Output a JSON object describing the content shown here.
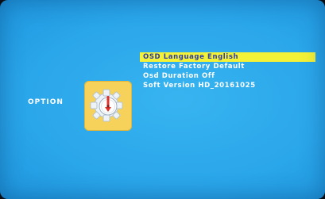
{
  "osd": {
    "section_label": "OPTION",
    "option_icon": "gear-clock-icon",
    "menu": [
      {
        "label": "OSD Language English",
        "selected": true
      },
      {
        "label": "Restore Factory Default",
        "selected": false
      },
      {
        "label": "Osd Duration Off",
        "selected": false
      },
      {
        "label": "Soft Version HD_20161025",
        "selected": false
      }
    ]
  },
  "colors": {
    "background": "#2aa6ea",
    "highlight": "#f4f236",
    "highlight_text": "#2f3ea8",
    "tile": "#f6d25a",
    "text": "#ffffff"
  }
}
